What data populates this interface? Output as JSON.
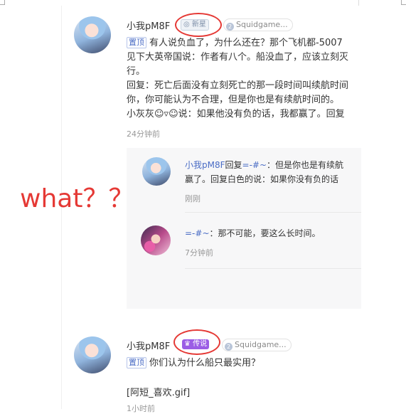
{
  "comments": [
    {
      "username": "小我pM8F",
      "badge": "新星",
      "group": "Squidgame...",
      "pinned": "置顶",
      "lines": [
        "有人说负血了，为什么还在？那个飞机都-5007",
        "见下大英帝国说：作者有八个。船没血了，应该立刻灭",
        "行。",
        "回复：死亡后面没有立刻死亡的那一段时间叫续航时间",
        "你，你可能认为不合理，但是你也是有续航时间的。",
        "小灰灰☺▿☺说：如果他没有负的话，我都赢了。回复"
      ],
      "time": "24分钟前"
    },
    {
      "username": "小我pM8F",
      "badge": "传说",
      "group": "Squidgame...",
      "pinned": "置顶",
      "lines": [
        "你们认为什么船只最实用？",
        "",
        "[阿短_喜欢.gif]"
      ],
      "time": "1小时前"
    }
  ],
  "replies": [
    {
      "username": "小我pM8F",
      "reply_word": "回复",
      "target": "=-#~",
      "line1": "：但是你也是有续航",
      "line2": "赢了。回复白色的说：如果你没有负的话",
      "time": "刚刚"
    },
    {
      "username": "=-#~",
      "text": "：那不可能，要这么长时间。",
      "time": "7分钟前"
    }
  ],
  "annotation": "what？？",
  "colors": {
    "link": "#4a6cc5",
    "annotation": "#e53935",
    "legend_badge": "#9b5de5"
  }
}
